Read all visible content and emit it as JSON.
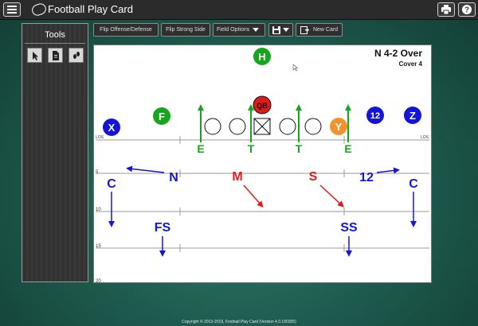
{
  "app": {
    "title": "Football Play Card",
    "footer": "Copyright © 2013-2019, Football Play Card (Version 4.0.190305)"
  },
  "tools": {
    "title": "Tools",
    "buttons": [
      {
        "icon": "pointer-icon"
      },
      {
        "icon": "document-icon"
      },
      {
        "icon": "footprint-icon"
      }
    ]
  },
  "toolbar": {
    "flip_offense_defense": "Flip Offense/Defense",
    "flip_strong_side": "Flip Strong Side",
    "field_options": "Field Options",
    "new_card": "New Card"
  },
  "play": {
    "name": "N 4-2 Over",
    "coverage": "Cover 4"
  },
  "field": {
    "yard_labels": [
      "LOS",
      "5",
      "10",
      "15",
      "20"
    ],
    "los_right": "LOS"
  },
  "players": {
    "offense": {
      "H": "H",
      "F": "F",
      "X": "X",
      "QB": "QB",
      "Y": "Y",
      "num12": "12",
      "Z": "Z"
    },
    "defense": {
      "E_left": "E",
      "T_left": "T",
      "T_right": "T",
      "E_right": "E",
      "N": "N",
      "M": "M",
      "S": "S",
      "num12": "12",
      "C_left": "C",
      "C_right": "C",
      "FS": "FS",
      "SS": "SS"
    }
  },
  "colors": {
    "green": "#16a51c",
    "blue": "#1414d8",
    "red": "#e01a1a",
    "orange": "#f3932f"
  }
}
